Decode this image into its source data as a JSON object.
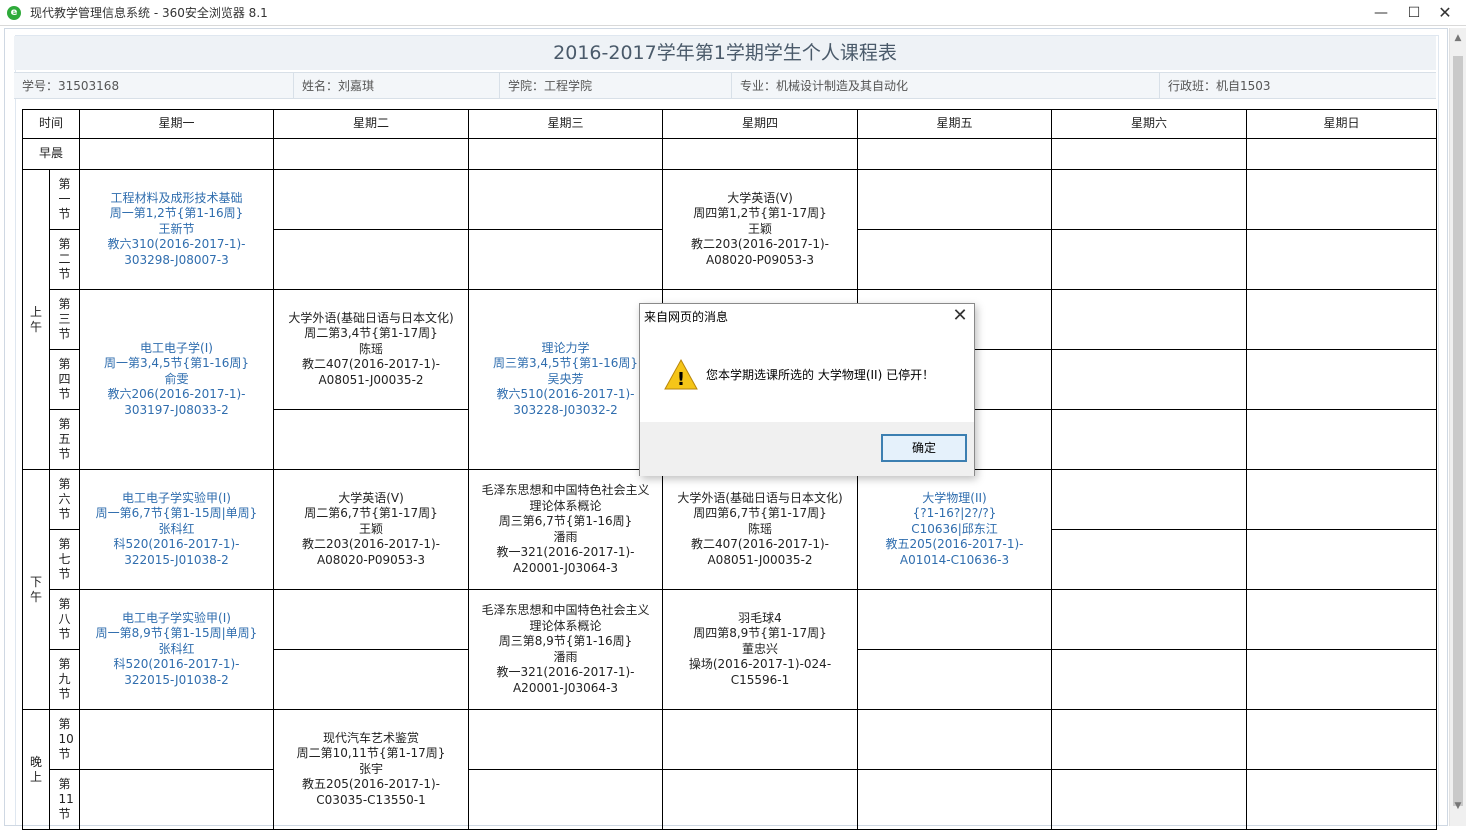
{
  "window": {
    "title": "现代教学管理信息系统 - 360安全浏览器 8.1",
    "app_icon_glyph": "e",
    "minimize_glyph": "—",
    "maximize_glyph": "☐",
    "close_glyph": "✕"
  },
  "page": {
    "title": "2016-2017学年第1学期学生个人课程表",
    "info": {
      "student_id": "学号：31503168",
      "name": "姓名：刘嘉琪",
      "college": "学院：工程学院",
      "major": "专业：机械设计制造及其自动化",
      "class": "行政班：机自1503"
    }
  },
  "schedule": {
    "header": {
      "time": "时间",
      "days": [
        "星期一",
        "星期二",
        "星期三",
        "星期四",
        "星期五",
        "星期六",
        "星期日"
      ]
    },
    "morning_early": "早晨",
    "sections": {
      "am": "上午",
      "pm": "下午",
      "eve": "晚上"
    },
    "slots": [
      "第一节",
      "第二节",
      "第三节",
      "第四节",
      "第五节",
      "第六节",
      "第七节",
      "第八节",
      "第九节",
      "第10节",
      "第11节"
    ],
    "courses": {
      "mon_12": [
        "工程材料及成形技术基础",
        "周一第1,2节{第1-16周}",
        "王新节",
        "教六310(2016-2017-1)-",
        "303298-J08007-3"
      ],
      "thu_12": [
        "大学英语(V)",
        "周四第1,2节{第1-17周}",
        "王颖",
        "教二203(2016-2017-1)-",
        "A08020-P09053-3"
      ],
      "mon_345": [
        "电工电子学(I)",
        "周一第3,4,5节{第1-16周}",
        "俞雯",
        "教六206(2016-2017-1)-",
        "303197-J08033-2"
      ],
      "tue_34": [
        "大学外语(基础日语与日本文化)",
        "周二第3,4节{第1-17周}",
        "陈瑶",
        "教二407(2016-2017-1)-",
        "A08051-J00035-2"
      ],
      "wed_345": [
        "理论力学",
        "周三第3,4,5节{第1-16周}",
        "吴央芳",
        "教六510(2016-2017-1)-",
        "303228-J03032-2"
      ],
      "mon_67": [
        "电工电子学实验甲(Ⅰ)",
        "周一第6,7节{第1-15周|单周}",
        "张科红",
        "科520(2016-2017-1)-",
        "322015-J01038-2"
      ],
      "tue_67": [
        "大学英语(V)",
        "周二第6,7节{第1-17周}",
        "王颖",
        "教二203(2016-2017-1)-",
        "A08020-P09053-3"
      ],
      "wed_67": [
        "毛泽东思想和中国特色社会主义",
        "理论体系概论",
        "周三第6,7节{第1-16周}",
        "潘雨",
        "教一321(2016-2017-1)-",
        "A20001-J03064-3"
      ],
      "thu_67": [
        "大学外语(基础日语与日本文化)",
        "周四第6,7节{第1-17周}",
        "陈瑶",
        "教二407(2016-2017-1)-",
        "A08051-J00035-2"
      ],
      "fri_67": [
        "大学物理(II)",
        "{?1-16?|2?/?}",
        "C10636|邱东江",
        "教五205(2016-2017-1)-",
        "A01014-C10636-3"
      ],
      "mon_89": [
        "电工电子学实验甲(Ⅰ)",
        "周一第8,9节{第1-15周|单周}",
        "张科红",
        "科520(2016-2017-1)-",
        "322015-J01038-2"
      ],
      "wed_89": [
        "毛泽东思想和中国特色社会主义",
        "理论体系概论",
        "周三第8,9节{第1-16周}",
        "潘雨",
        "教一321(2016-2017-1)-",
        "A20001-J03064-3"
      ],
      "thu_89": [
        "羽毛球4",
        "周四第8,9节{第1-17周}",
        "董忠兴",
        "操场(2016-2017-1)-024-",
        "C15596-1"
      ],
      "tue_1011": [
        "现代汽车艺术鉴赏",
        "周二第10,11节{第1-17周}",
        "张宇",
        "教五205(2016-2017-1)-",
        "C03035-C13550-1"
      ]
    }
  },
  "dialog": {
    "title": "来自网页的消息",
    "message": "您本学期选课所选的 大学物理(II) 已停开！",
    "ok": "确定",
    "close_glyph": "✕",
    "warning_glyph": "!"
  },
  "scrollbar": {
    "up_glyph": "▲",
    "down_glyph": "▼"
  }
}
